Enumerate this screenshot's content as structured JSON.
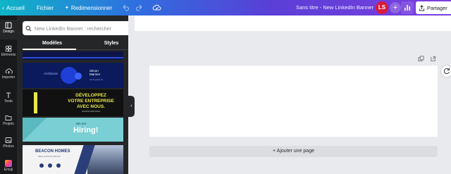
{
  "topbar": {
    "home_label": "Accueil",
    "file_label": "Fichier",
    "resize_label": "Redimensionner",
    "title": "Sans titre - New LinkedIn Banner",
    "avatar_initials": "LS",
    "share_label": "Partager"
  },
  "rail": {
    "items": [
      {
        "label": "Design",
        "icon": "layout-icon"
      },
      {
        "label": "Éléments",
        "icon": "shapes-icon"
      },
      {
        "label": "Importer",
        "icon": "upload-cloud-icon"
      },
      {
        "label": "Texte",
        "icon": "text-icon"
      },
      {
        "label": "Projets",
        "icon": "folder-icon"
      },
      {
        "label": "Photos",
        "icon": "image-icon"
      },
      {
        "label": "Emoji",
        "icon": "emoji-icon"
      }
    ]
  },
  "panel": {
    "search_placeholder": "New LinkedIn Banner : rechercher",
    "tabs": [
      "Modèles",
      "Styles"
    ],
    "templates": {
      "t1": {
        "name": "Simon Mariner",
        "role": "Architecte",
        "small": "123 Anywhere St."
      },
      "t2": {
        "line1": "DÉVELOPPEZ",
        "line2": "VOTRE ENTREPRISE",
        "line3": "AVEC NOUS.",
        "sub": "SOCIÉTÉ MARCHAND"
      },
      "t3": {
        "pre": "We are",
        "main": "Hiring!"
      },
      "t4": {
        "brand": "BEACON HOMES",
        "sub": "REAL ESTATE GROUP"
      }
    }
  },
  "canvas": {
    "add_page_label": "+ Ajouter une page"
  },
  "colors": {
    "topbar_gradient_start": "#0fb5c7",
    "topbar_gradient_end": "#7b3fe0",
    "avatar": "#d81b3c",
    "rail_bg": "#18191b",
    "panel_bg": "#252627",
    "workspace_bg": "#e9eaee"
  }
}
